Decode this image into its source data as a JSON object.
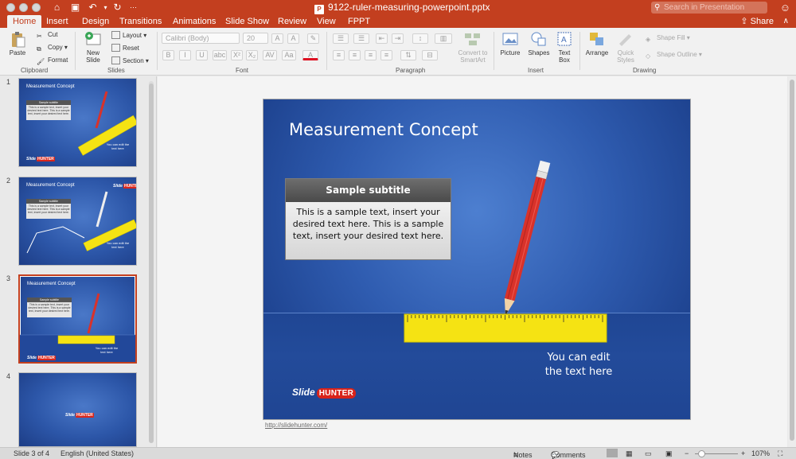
{
  "window": {
    "filename": "9122-ruler-measuring-powerpoint.pptx",
    "search_placeholder": "Search in Presentation"
  },
  "tabs": [
    "Home",
    "Insert",
    "Design",
    "Transitions",
    "Animations",
    "Slide Show",
    "Review",
    "View",
    "FPPT"
  ],
  "active_tab": "Home",
  "share_label": "Share",
  "ribbon": {
    "clipboard": {
      "paste": "Paste",
      "cut": "Cut",
      "copy": "Copy",
      "format": "Format",
      "label": "Clipboard"
    },
    "slides": {
      "new_slide": "New Slide",
      "layout": "Layout",
      "reset": "Reset",
      "section": "Section",
      "label": "Slides"
    },
    "font": {
      "family": "Calibri (Body)",
      "size": "20",
      "label": "Font",
      "buttons": [
        "B",
        "I",
        "U",
        "abc",
        "X²",
        "X₂",
        "AV",
        "Aa",
        "A"
      ]
    },
    "paragraph": {
      "convert": "Convert to SmartArt",
      "label": "Paragraph"
    },
    "insert": {
      "picture": "Picture",
      "shapes": "Shapes",
      "textbox": "Text Box",
      "label": "Insert"
    },
    "drawing": {
      "arrange": "Arrange",
      "quick_styles": "Quick Styles",
      "shape_fill": "Shape Fill",
      "shape_outline": "Shape Outline",
      "label": "Drawing"
    }
  },
  "thumbnails": [
    {
      "num": "1",
      "title": "Measurement Concept",
      "subtitle": "Sample subtitle",
      "text": "This is a sample text, insert your desired text here. This is a sample text, insert your desired text here.",
      "edit": "You can edit the text here"
    },
    {
      "num": "2",
      "title": "Measurement Concept",
      "subtitle": "Sample subtitle",
      "text": "This is a sample text, insert your desired text here. This is a sample text, insert your desired text here.",
      "edit": "You can edit the text here"
    },
    {
      "num": "3",
      "title": "Measurement Concept",
      "subtitle": "Sample subtitle",
      "text": "This is a sample text, insert your desired text here. This is a sample text, insert your desired text here.",
      "edit": "You can edit the text here"
    },
    {
      "num": "4"
    }
  ],
  "selected_slide": 3,
  "slide": {
    "title": "Measurement Concept",
    "box_title": "Sample subtitle",
    "box_text": "This is a sample text, insert your desired text here. This is a sample text, insert your desired text here.",
    "edit_text_1": "You can edit",
    "edit_text_2": "the text here",
    "logo_slide": "Slide",
    "logo_hunter": "HUNTER",
    "url": "http://slidehunter.com/"
  },
  "status": {
    "slide_info": "Slide 3 of 4",
    "language": "English (United States)",
    "notes": "Notes",
    "comments": "Comments",
    "zoom": "107%"
  },
  "colors": {
    "accent": "#c33f1f",
    "slide_blue": "#2f5cb0",
    "ruler_yellow": "#f5e313",
    "pencil_red": "#d9322a"
  }
}
